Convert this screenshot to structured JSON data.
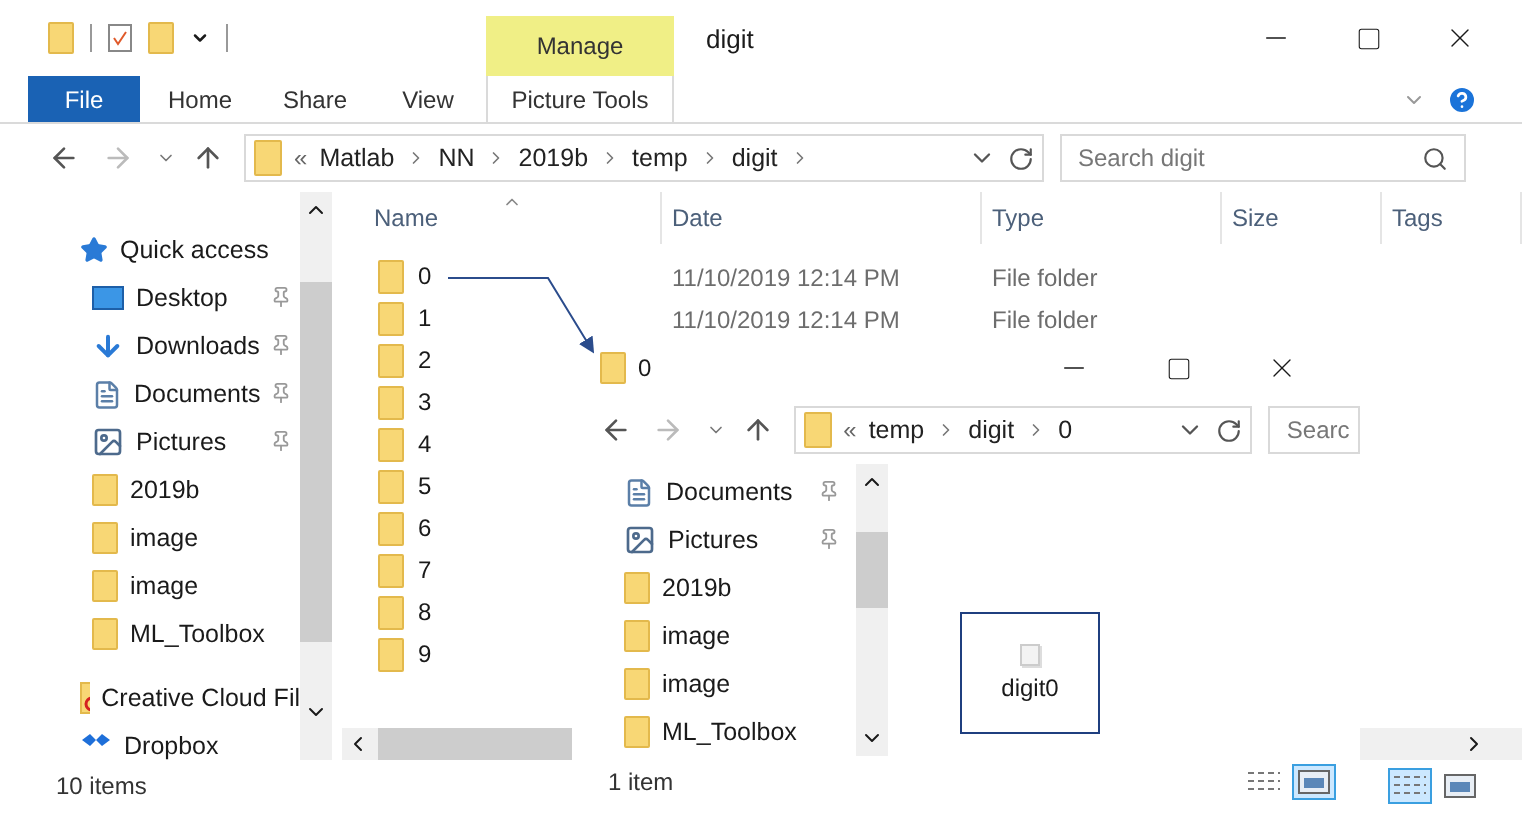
{
  "window": {
    "title": "digit"
  },
  "contextual_tab": {
    "group": "Manage"
  },
  "ribbon_tabs": [
    {
      "label": "File",
      "kind": "file"
    },
    {
      "label": "Home",
      "kind": "tab"
    },
    {
      "label": "Share",
      "kind": "tab"
    },
    {
      "label": "View",
      "kind": "tab"
    },
    {
      "label": "Picture Tools",
      "kind": "contextual"
    }
  ],
  "address": {
    "overflow_mark": "«",
    "path": [
      "Matlab",
      "NN",
      "2019b",
      "temp",
      "digit"
    ]
  },
  "search": {
    "placeholder": "Search digit"
  },
  "columns": [
    {
      "label": "Name",
      "sorted": true
    },
    {
      "label": "Date",
      "sorted": false
    },
    {
      "label": "Type",
      "sorted": false
    },
    {
      "label": "Size",
      "sorted": false
    },
    {
      "label": "Tags",
      "sorted": false
    }
  ],
  "sidebar": [
    {
      "label": "Quick access",
      "kind": "star",
      "pinned": false
    },
    {
      "label": "Desktop",
      "kind": "desktop",
      "pinned": true
    },
    {
      "label": "Downloads",
      "kind": "downloads",
      "pinned": true
    },
    {
      "label": "Documents",
      "kind": "documents",
      "pinned": true
    },
    {
      "label": "Pictures",
      "kind": "pictures",
      "pinned": true
    },
    {
      "label": "2019b",
      "kind": "folder",
      "pinned": false
    },
    {
      "label": "image",
      "kind": "folder",
      "pinned": false
    },
    {
      "label": "image",
      "kind": "folder",
      "pinned": false
    },
    {
      "label": "ML_Toolbox",
      "kind": "folder",
      "pinned": false
    },
    {
      "label": "Creative Cloud Fil",
      "kind": "cloud",
      "pinned": false
    },
    {
      "label": "Dropbox",
      "kind": "dropbox",
      "pinned": false
    }
  ],
  "files": [
    {
      "name": "0",
      "date": "11/10/2019 12:14 PM",
      "type": "File folder"
    },
    {
      "name": "1",
      "date": "11/10/2019 12:14 PM",
      "type": "File folder"
    },
    {
      "name": "2"
    },
    {
      "name": "3"
    },
    {
      "name": "4"
    },
    {
      "name": "5"
    },
    {
      "name": "6"
    },
    {
      "name": "7"
    },
    {
      "name": "8"
    },
    {
      "name": "9"
    }
  ],
  "status_bar": {
    "count": "10 items",
    "views": [
      {
        "kind": "details",
        "selected": true
      },
      {
        "kind": "thumbnails",
        "selected": false
      }
    ]
  },
  "second_window": {
    "title": "0",
    "address": {
      "overflow_mark": "«",
      "path": [
        "temp",
        "digit",
        "0"
      ]
    },
    "search": {
      "placeholder": "Searc"
    },
    "sidebar": [
      {
        "label": "Documents",
        "kind": "documents",
        "pinned": true
      },
      {
        "label": "Pictures",
        "kind": "pictures",
        "pinned": true
      },
      {
        "label": "2019b",
        "kind": "folder",
        "pinned": false
      },
      {
        "label": "image",
        "kind": "folder",
        "pinned": false
      },
      {
        "label": "image",
        "kind": "folder",
        "pinned": false
      },
      {
        "label": "ML_Toolbox",
        "kind": "folder",
        "pinned": false
      }
    ],
    "files": [
      {
        "name": "digit0",
        "selected": true
      }
    ],
    "status_bar": {
      "count": "1 item",
      "views": [
        {
          "kind": "details",
          "selected": false
        },
        {
          "kind": "thumbnails",
          "selected": true
        }
      ]
    }
  }
}
